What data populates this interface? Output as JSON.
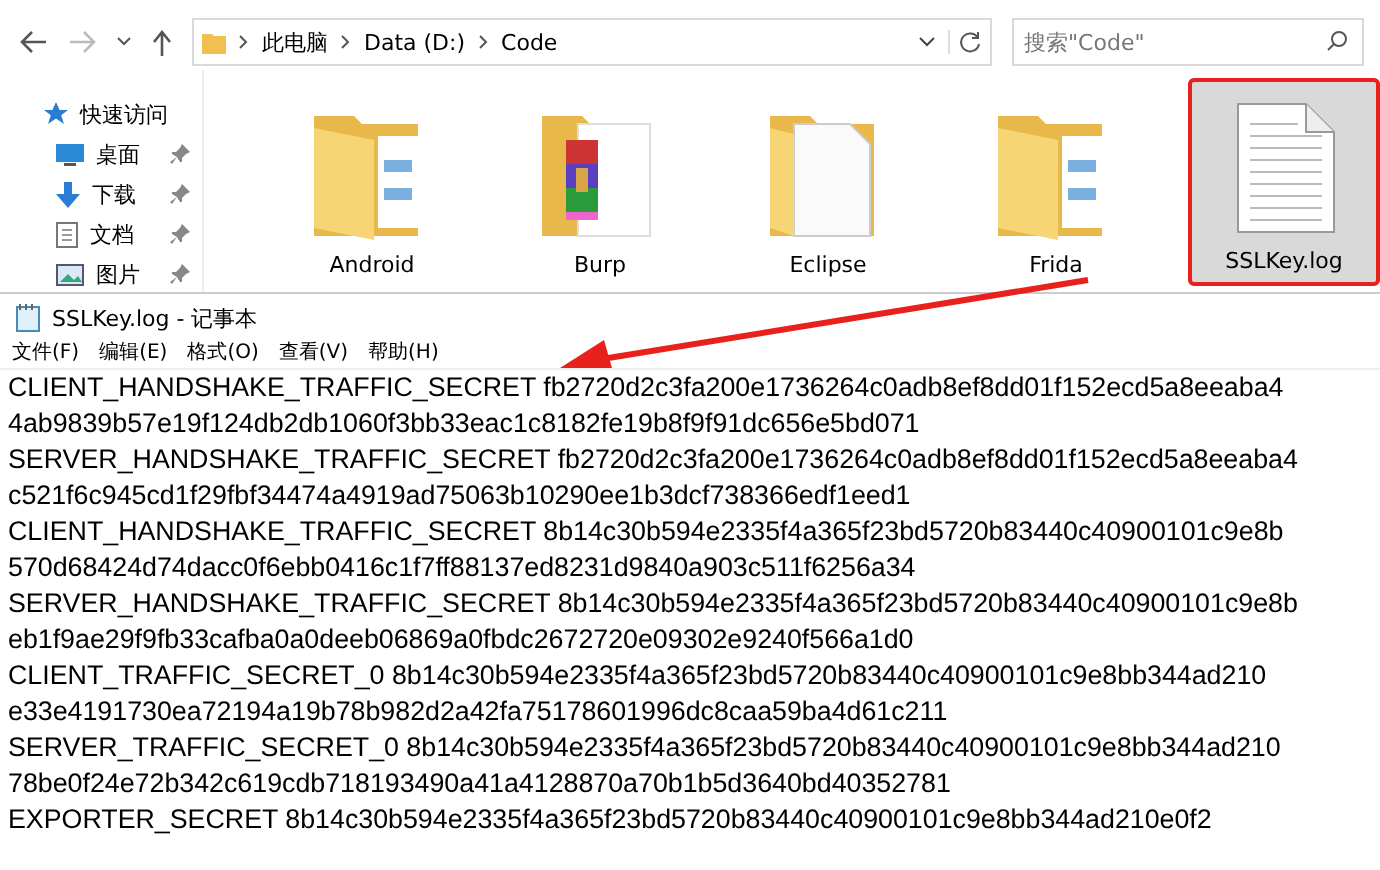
{
  "explorer": {
    "breadcrumb": [
      "此电脑",
      "Data (D:)",
      "Code"
    ],
    "search": {
      "placeholder": "搜索\"Code\""
    },
    "sidebar": {
      "heading": "快速访问",
      "items": [
        {
          "label": "桌面",
          "pinned": true
        },
        {
          "label": "下载",
          "pinned": true
        },
        {
          "label": "文档",
          "pinned": true
        },
        {
          "label": "图片",
          "pinned": true
        }
      ]
    },
    "files": [
      {
        "name": "Android",
        "kind": "folder",
        "selected": false,
        "annotated": false
      },
      {
        "name": "Burp",
        "kind": "archive",
        "selected": false,
        "annotated": false
      },
      {
        "name": "Eclipse",
        "kind": "paper-folder",
        "selected": false,
        "annotated": false
      },
      {
        "name": "Frida",
        "kind": "folder",
        "selected": false,
        "annotated": false
      },
      {
        "name": "SSLKey.log",
        "kind": "text-file",
        "selected": true,
        "annotated": true
      }
    ]
  },
  "notepad": {
    "title": "SSLKey.log - 记事本",
    "menu": [
      "文件(F)",
      "编辑(E)",
      "格式(O)",
      "查看(V)",
      "帮助(H)"
    ],
    "lines": [
      "CLIENT_HANDSHAKE_TRAFFIC_SECRET fb2720d2c3fa200e1736264c0adb8ef8dd01f152ecd5a8eeaba4",
      "4ab9839b57e19f124db2db1060f3bb33eac1c8182fe19b8f9f91dc656e5bd071",
      "SERVER_HANDSHAKE_TRAFFIC_SECRET fb2720d2c3fa200e1736264c0adb8ef8dd01f152ecd5a8eeaba4",
      "c521f6c945cd1f29fbf34474a4919ad75063b10290ee1b3dcf738366edf1eed1",
      "CLIENT_HANDSHAKE_TRAFFIC_SECRET 8b14c30b594e2335f4a365f23bd5720b83440c40900101c9e8b",
      "570d68424d74dacc0f6ebb0416c1f7ff88137ed8231d9840a903c511f6256a34",
      "SERVER_HANDSHAKE_TRAFFIC_SECRET 8b14c30b594e2335f4a365f23bd5720b83440c40900101c9e8b",
      "eb1f9ae29f9fb33cafba0a0deeb06869a0fbdc2672720e09302e9240f566a1d0",
      "CLIENT_TRAFFIC_SECRET_0 8b14c30b594e2335f4a365f23bd5720b83440c40900101c9e8bb344ad210",
      "e33e4191730ea72194a19b78b982d2a42fa75178601996dc8caa59ba4d61c211",
      "SERVER_TRAFFIC_SECRET_0 8b14c30b594e2335f4a365f23bd5720b83440c40900101c9e8bb344ad210",
      "78be0f24e72b342c619cdb718193490a41a4128870a70b1b5d3640bd40352781",
      "EXPORTER_SECRET 8b14c30b594e2335f4a365f23bd5720b83440c40900101c9e8bb344ad210e0f2"
    ]
  }
}
